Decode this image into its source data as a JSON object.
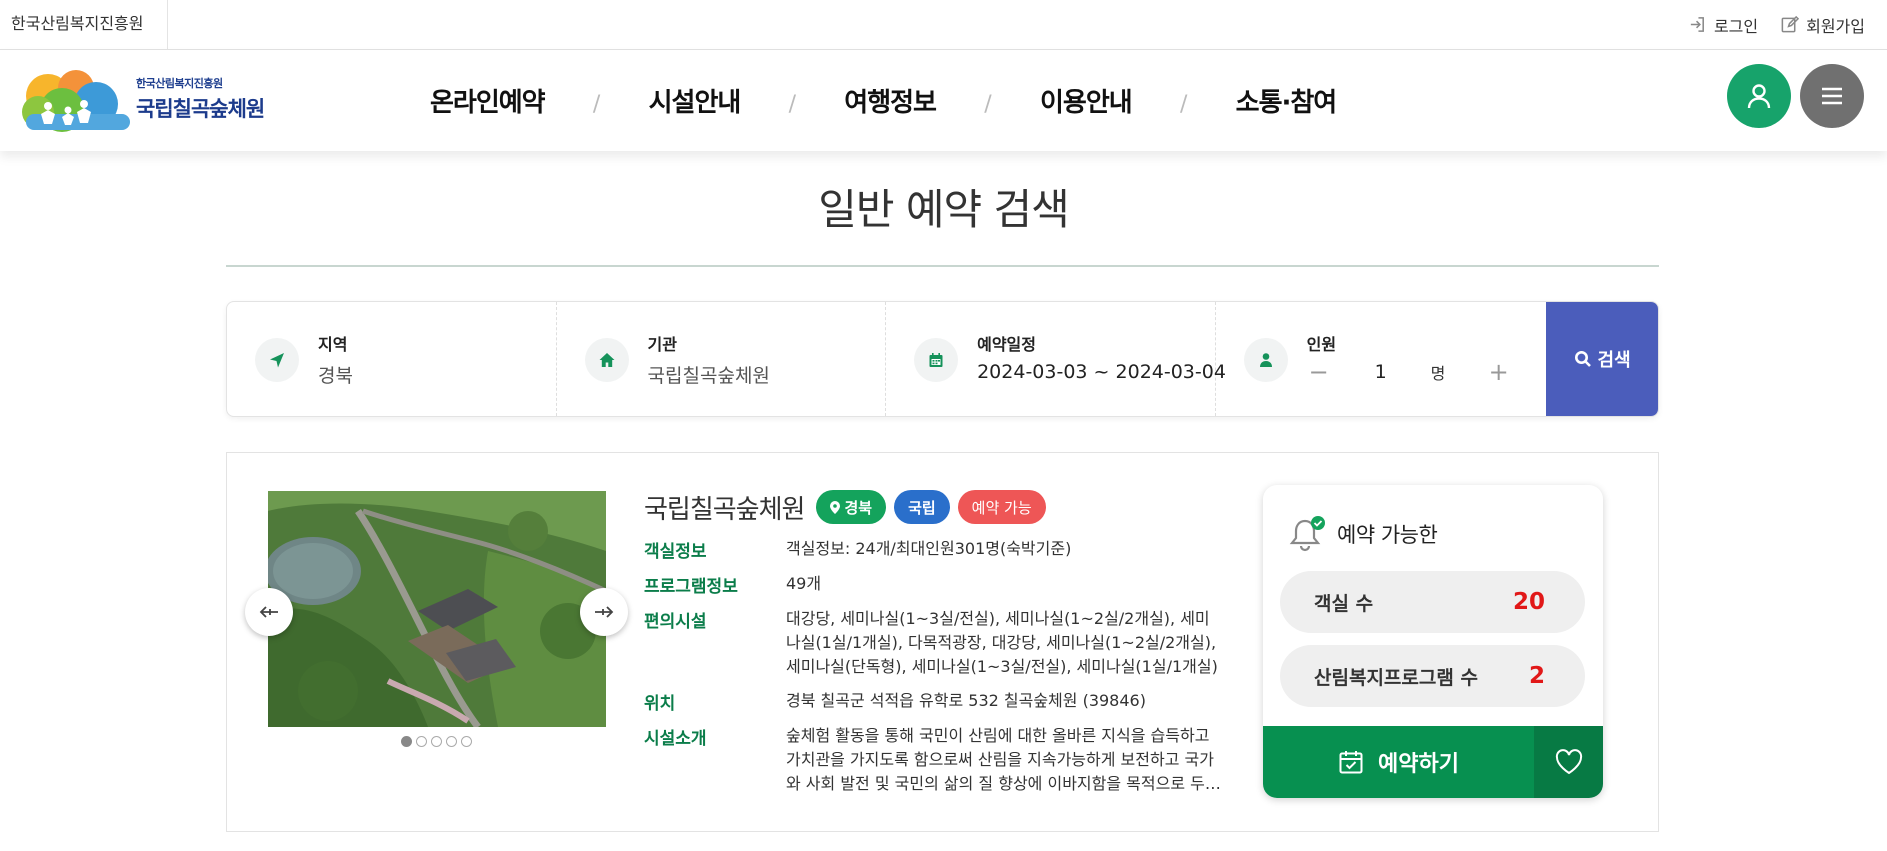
{
  "topbar": {
    "org_name": "한국산림복지진흥원",
    "login_label": "로그인",
    "signup_label": "회원가입"
  },
  "header": {
    "logo_sub": "한국산림복지진흥원",
    "logo_main": "국립칠곡숲체원",
    "nav": [
      "온라인예약",
      "시설안내",
      "여행정보",
      "이용안내",
      "소통·참여"
    ],
    "nav_separator": "/",
    "icons": {
      "user": "user-icon",
      "menu": "hamburger-menu-icon"
    }
  },
  "page": {
    "title": "일반 예약 검색"
  },
  "search": {
    "region": {
      "label": "지역",
      "value": "경북",
      "icon": "location-arrow-icon"
    },
    "facility": {
      "label": "기관",
      "value": "국립칠곡숲체원",
      "icon": "home-icon"
    },
    "dates": {
      "label": "예약일정",
      "value": "2024-03-03 ~ 2024-03-04",
      "icon": "calendar-icon"
    },
    "people": {
      "label": "인원",
      "count": "1",
      "unit": "명",
      "minus": "−",
      "plus": "+",
      "icon": "person-icon"
    },
    "button_label": "검색"
  },
  "result": {
    "name": "국립칠곡숲체원",
    "tags": {
      "region": "경북",
      "type": "국립",
      "status": "예약 가능"
    },
    "rows": [
      {
        "key": "객실정보",
        "value": "객실정보: 24개/최대인원301명(숙박기준)"
      },
      {
        "key": "프로그램정보",
        "value": "49개"
      },
      {
        "key": "편의시설",
        "value": "대강당, 세미나실(1~3실/전실), 세미나실(1~2실/2개실), 세미나실(1실/1개실), 다목적광장, 대강당, 세미나실(1~2실/2개실), 세미나실(단독형), 세미나실(1~3실/전실), 세미나실(1실/1개실)"
      },
      {
        "key": "위치",
        "value": "경북 칠곡군 석적읍 유학로 532 칠곡숲체원 (39846)"
      },
      {
        "key": "시설소개",
        "value": "숲체험 활동을 통해 국민이 산림에 대한 올바른 지식을 습득하고 가치관을 가지도록 함으로써 산림을 지속가능하게 보전하고 국가와 사회 발전 및 국민의 삶의 질 향상에 이바지함을 목적으로 두…"
      }
    ],
    "slider": {
      "slide_count": 5,
      "active_slide": 1
    },
    "availability": {
      "title": "예약 가능한",
      "rooms_label": "객실 수",
      "rooms_value": "20",
      "programs_label": "산림복지프로그램 수",
      "programs_value": "2",
      "reserve_label": "예약하기"
    }
  },
  "colors": {
    "green": "#079050",
    "green_dark": "#077a44",
    "blue_search": "#4b5dbb",
    "tag_region": "#14a35c",
    "tag_type": "#2a6fcb",
    "tag_status": "#ee5656",
    "available_count": "#e11818",
    "label_green": "#0b7d4a"
  }
}
